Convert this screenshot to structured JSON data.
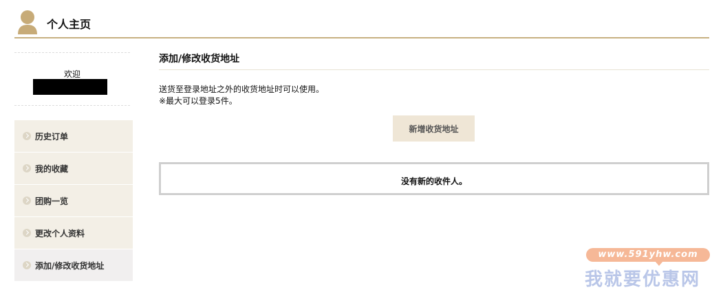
{
  "header": {
    "title": "个人主页",
    "icon": "user-avatar-icon",
    "accent_color": "#c7b080"
  },
  "sidebar": {
    "welcome": "欢迎",
    "items": [
      {
        "label": "历史订单"
      },
      {
        "label": "我的收藏"
      },
      {
        "label": "团购一览"
      },
      {
        "label": "更改个人资料"
      },
      {
        "label": "添加/修改收货地址",
        "active": true
      }
    ]
  },
  "main": {
    "title": "添加/修改收货地址",
    "desc_line1": "送货至登录地址之外的收货地址时可以使用。",
    "desc_line2": "※最大可以登录5件。",
    "add_button": "新增收货地址",
    "empty_message": "没有新的收件人。"
  },
  "watermark": {
    "url": "www.591yhw.com",
    "name": "我就要优惠网"
  }
}
